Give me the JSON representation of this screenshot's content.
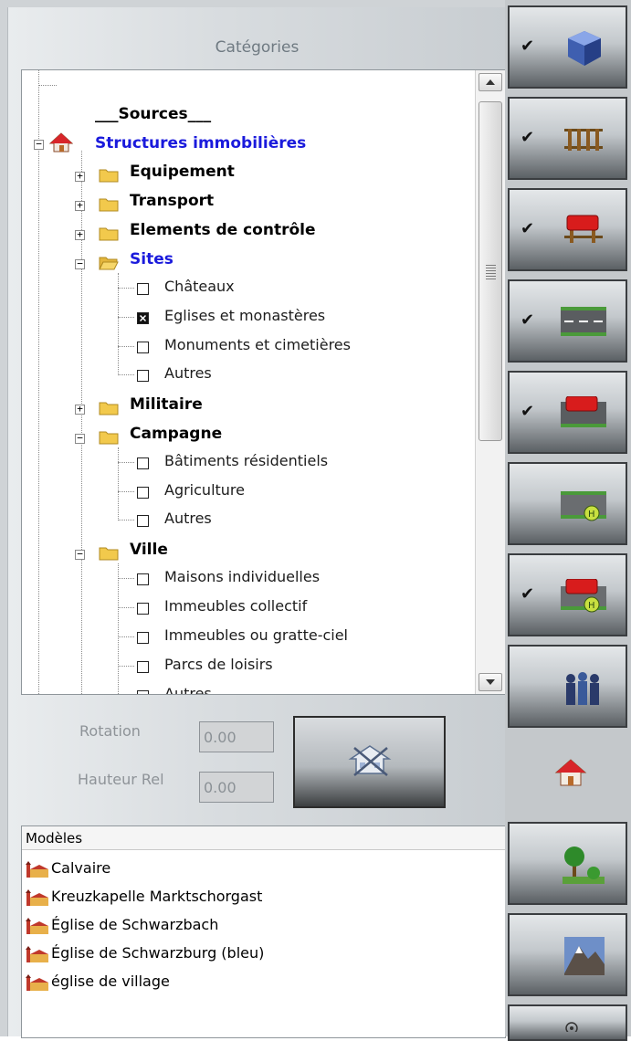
{
  "categories_title": "Catégories",
  "tree": {
    "sources_label": "___Sources___",
    "root_label": "Structures immobilières",
    "folders": [
      {
        "label": "Equipement",
        "expanded": false
      },
      {
        "label": "Transport",
        "expanded": false
      },
      {
        "label": "Elements de contrôle",
        "expanded": false
      },
      {
        "label": "Sites",
        "expanded": true,
        "selected": true,
        "children": [
          {
            "label": "Châteaux",
            "checked": false
          },
          {
            "label": "Eglises et monastères",
            "checked": true
          },
          {
            "label": "Monuments et cimetières",
            "checked": false
          },
          {
            "label": "Autres",
            "checked": false
          }
        ]
      },
      {
        "label": "Militaire",
        "expanded": false
      },
      {
        "label": "Campagne",
        "expanded": true,
        "children": [
          {
            "label": "Bâtiments résidentiels",
            "checked": false
          },
          {
            "label": "Agriculture",
            "checked": false
          },
          {
            "label": "Autres",
            "checked": false
          }
        ]
      },
      {
        "label": "Ville",
        "expanded": true,
        "children": [
          {
            "label": "Maisons individuelles",
            "checked": false
          },
          {
            "label": "Immeubles collectif",
            "checked": false
          },
          {
            "label": "Immeubles ou gratte-ciel",
            "checked": false
          },
          {
            "label": "Parcs de loisirs",
            "checked": false
          },
          {
            "label": "Autres",
            "checked": false
          }
        ]
      }
    ]
  },
  "controls": {
    "rotation_label": "Rotation",
    "rotation_value": "0.00",
    "height_label": "Hauteur Rel",
    "height_value": "0.00"
  },
  "models": {
    "header": "Modèles",
    "items": [
      "Calvaire",
      "Kreuzkapelle Marktschorgast",
      "Église de Schwarzbach",
      "Église de Schwarzburg (bleu)",
      "église de village"
    ]
  },
  "toolbar": [
    {
      "name": "track-objects-button",
      "icon": "cube-icon",
      "checked": true
    },
    {
      "name": "rails-button",
      "icon": "rail-track-icon",
      "checked": true
    },
    {
      "name": "rail-vehicles-button",
      "icon": "rail-vehicle-icon",
      "checked": true
    },
    {
      "name": "roads-button",
      "icon": "road-icon",
      "checked": true
    },
    {
      "name": "road-vehicles-button",
      "icon": "road-vehicle-icon",
      "checked": true
    },
    {
      "name": "waterways-button",
      "icon": "waterway-icon",
      "checked": false
    },
    {
      "name": "water-vehicles-button",
      "icon": "water-vehicle-icon",
      "checked": true
    },
    {
      "name": "people-button",
      "icon": "people-icon",
      "checked": false
    },
    {
      "name": "buildings-button",
      "icon": "house-icon",
      "active": true
    },
    {
      "name": "landscape-button",
      "icon": "tree-icon",
      "checked": false
    },
    {
      "name": "terrain-button",
      "icon": "mountain-icon",
      "checked": false
    },
    {
      "name": "more-button",
      "icon": "eye-icon",
      "checked": false
    }
  ],
  "colors": {
    "selected_text": "#1a1adc",
    "panel_bg": "#d9dde0",
    "folder": "#f2c94c"
  }
}
